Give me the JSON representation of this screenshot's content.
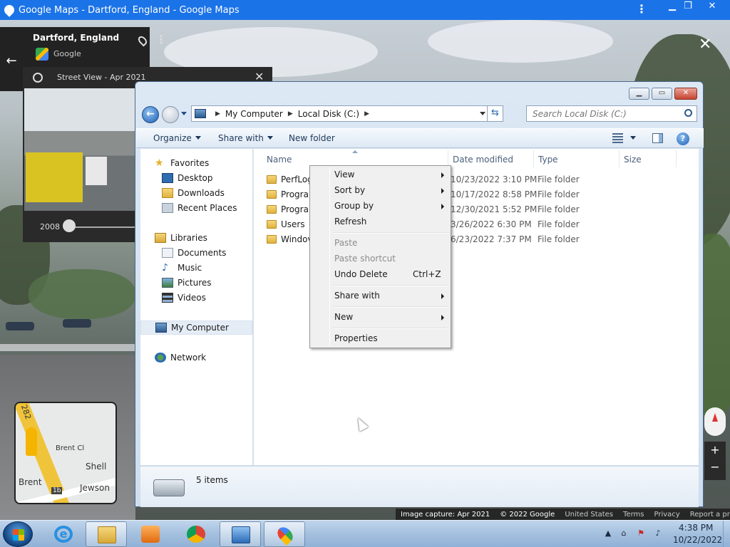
{
  "app": {
    "title": "Google Maps - Dartford, England - Google Maps",
    "place_name": "Dartford, England",
    "place_source": "Google",
    "street_view_label": "Street View - Apr 2021",
    "timeline_year": "2008"
  },
  "minimap": {
    "labels": [
      "282",
      "Brent Cl",
      "Shell",
      "Brent",
      "1b",
      "Jewson"
    ]
  },
  "attribution": {
    "capture": "Image capture: Apr 2021",
    "copyright": "© 2022 Google",
    "links": [
      "United States",
      "Terms",
      "Privacy",
      "Report a problem"
    ]
  },
  "explorer": {
    "breadcrumb": [
      "My Computer",
      "Local Disk (C:)"
    ],
    "search_placeholder": "Search Local Disk (C:)",
    "toolbar": {
      "organize": "Organize",
      "share_with": "Share with",
      "new_folder": "New folder"
    },
    "nav": {
      "favorites": "Favorites",
      "favorites_items": [
        "Desktop",
        "Downloads",
        "Recent Places"
      ],
      "libraries": "Libraries",
      "libraries_items": [
        "Documents",
        "Music",
        "Pictures",
        "Videos"
      ],
      "computer": "My Computer",
      "network": "Network"
    },
    "columns": {
      "name": "Name",
      "date": "Date modified",
      "type": "Type",
      "size": "Size"
    },
    "files": [
      {
        "name": "PerfLog",
        "date": "10/23/2022 3:10 PM",
        "type": "File folder"
      },
      {
        "name": "Prograr",
        "date": "10/17/2022 8:58 PM",
        "type": "File folder"
      },
      {
        "name": "Prograr",
        "date": "12/30/2021 5:52 PM",
        "type": "File folder"
      },
      {
        "name": "Users",
        "date": "3/26/2022 6:30 PM",
        "type": "File folder"
      },
      {
        "name": "Windov",
        "date": "6/23/2022 7:37 PM",
        "type": "File folder"
      }
    ],
    "status": "5 items"
  },
  "context_menu": {
    "view": "View",
    "sort_by": "Sort by",
    "group_by": "Group by",
    "refresh": "Refresh",
    "paste": "Paste",
    "paste_shortcut": "Paste shortcut",
    "undo_delete": "Undo Delete",
    "undo_shortcut": "Ctrl+Z",
    "share_with": "Share with",
    "new": "New",
    "properties": "Properties"
  },
  "taskbar": {
    "time": "4:38 PM",
    "date": "10/22/2022"
  }
}
